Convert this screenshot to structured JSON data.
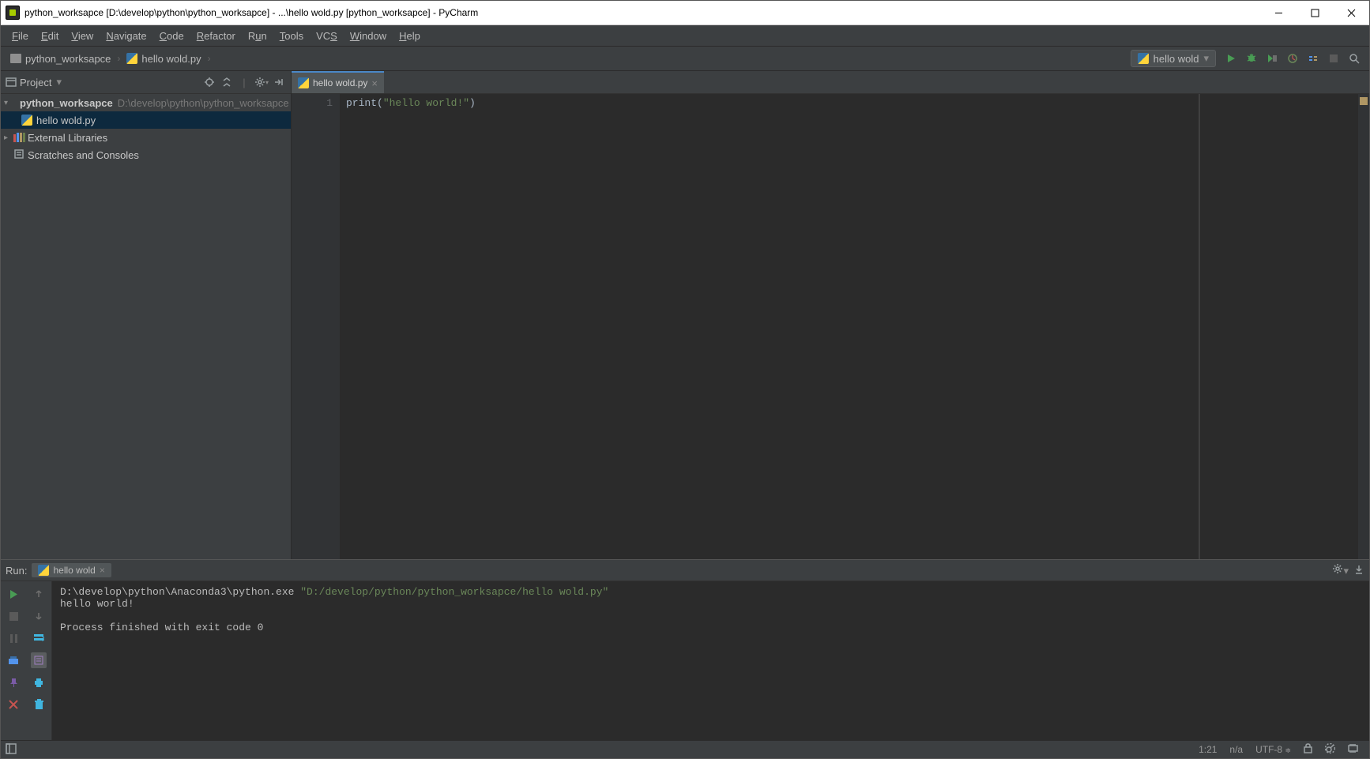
{
  "window": {
    "title": "python_worksapce [D:\\develop\\python\\python_worksapce] - ...\\hello wold.py [python_worksapce] - PyCharm"
  },
  "menu": {
    "file": "File",
    "edit": "Edit",
    "view": "View",
    "navigate": "Navigate",
    "code": "Code",
    "refactor": "Refactor",
    "run": "Run",
    "tools": "Tools",
    "vcs": "VCS",
    "window": "Window",
    "help": "Help"
  },
  "breadcrumbs": {
    "root": "python_worksapce",
    "file": "hello wold.py"
  },
  "run_config": {
    "name": "hello wold"
  },
  "project_tool": {
    "label": "Project",
    "root": {
      "name": "python_worksapce",
      "path": "D:\\develop\\python\\python_worksapce"
    },
    "file": "hello wold.py",
    "ext_lib": "External Libraries",
    "scratch": "Scratches and Consoles"
  },
  "editor": {
    "tab": "hello wold.py",
    "line_no": "1",
    "code_fn": "print",
    "code_open": "(",
    "code_str": "\"hello world!\"",
    "code_close": ")"
  },
  "run_panel": {
    "title": "Run:",
    "tab": "hello wold",
    "cmd_prefix": "D:\\develop\\python\\Anaconda3\\python.exe ",
    "cmd_arg": "\"D:/develop/python/python_worksapce/hello wold.py\"",
    "out": "hello world!",
    "exit": "Process finished with exit code 0"
  },
  "status": {
    "pos": "1:21",
    "sep": "n/a",
    "enc": "UTF-8"
  }
}
